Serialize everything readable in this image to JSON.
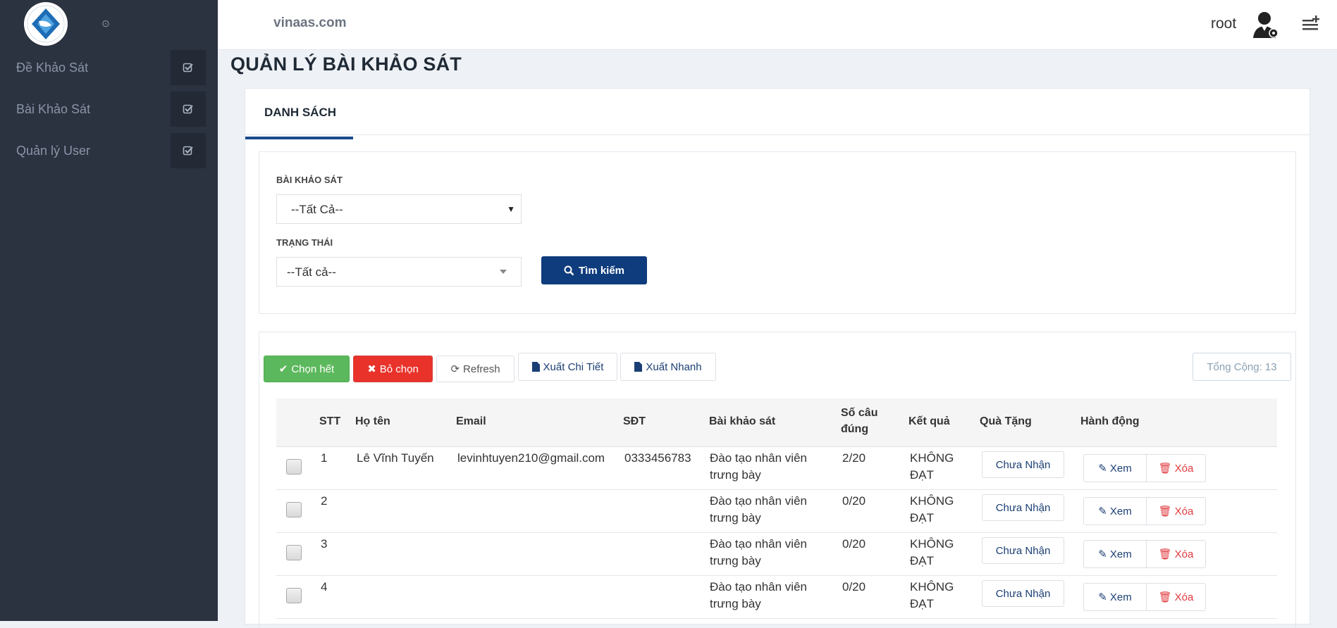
{
  "header": {
    "brand": "vinaas.com",
    "user": "root"
  },
  "sidebar": {
    "items": [
      {
        "label": "Đề Khảo Sát"
      },
      {
        "label": "Bài Khảo Sát"
      },
      {
        "label": "Quản lý User"
      }
    ]
  },
  "page": {
    "title": "QUẢN LÝ BÀI KHẢO SÁT",
    "tab": "DANH SÁCH"
  },
  "filters": {
    "survey_label": "BÀI KHẢO SÁT",
    "survey_value": "--Tất Cả--",
    "status_label": "TRẠNG THÁI",
    "status_value": "--Tất cả--",
    "search_button": "Tìm kiếm"
  },
  "toolbar": {
    "select_all": "Chọn hết",
    "deselect": "Bỏ chọn",
    "refresh": "Refresh",
    "export_detail": "Xuất Chi Tiết",
    "export_quick": "Xuất Nhanh",
    "total": "Tổng Cộng: 13"
  },
  "table": {
    "headers": {
      "stt": "STT",
      "name": "Họ tên",
      "email": "Email",
      "phone": "SĐT",
      "survey": "Bài khảo sát",
      "correct_1": "Số câu",
      "correct_2": "đúng",
      "result": "Kết quả",
      "gift": "Quà Tặng",
      "action": "Hành động"
    },
    "rows": [
      {
        "stt": "1",
        "name": "Lê Vĩnh Tuyến",
        "email": "levinhtuyen210@gmail.com",
        "phone": "0333456783",
        "survey_1": "Đào tạo nhân viên",
        "survey_2": "trưng bày",
        "score": "2/20",
        "result_1": "KHÔNG",
        "result_2": "ĐẠT",
        "gift": "Chưa Nhận",
        "view": "Xem",
        "delete": "Xóa"
      },
      {
        "stt": "2",
        "name": "",
        "email": "",
        "phone": "",
        "survey_1": "Đào tạo nhân viên",
        "survey_2": "trưng bày",
        "score": "0/20",
        "result_1": "KHÔNG",
        "result_2": "ĐẠT",
        "gift": "Chưa Nhận",
        "view": "Xem",
        "delete": "Xóa"
      },
      {
        "stt": "3",
        "name": "",
        "email": "",
        "phone": "",
        "survey_1": "Đào tạo nhân viên",
        "survey_2": "trưng bày",
        "score": "0/20",
        "result_1": "KHÔNG",
        "result_2": "ĐẠT",
        "gift": "Chưa Nhận",
        "view": "Xem",
        "delete": "Xóa"
      },
      {
        "stt": "4",
        "name": "",
        "email": "",
        "phone": "",
        "survey_1": "Đào tạo nhân viên",
        "survey_2": "trưng bày",
        "score": "0/20",
        "result_1": "KHÔNG",
        "result_2": "ĐẠT",
        "gift": "Chưa Nhận",
        "view": "Xem",
        "delete": "Xóa"
      }
    ]
  },
  "colors": {
    "sidebar": "#2b3240",
    "primary": "#0f3c7c",
    "green": "#5cb85c",
    "red": "#e8322a"
  }
}
